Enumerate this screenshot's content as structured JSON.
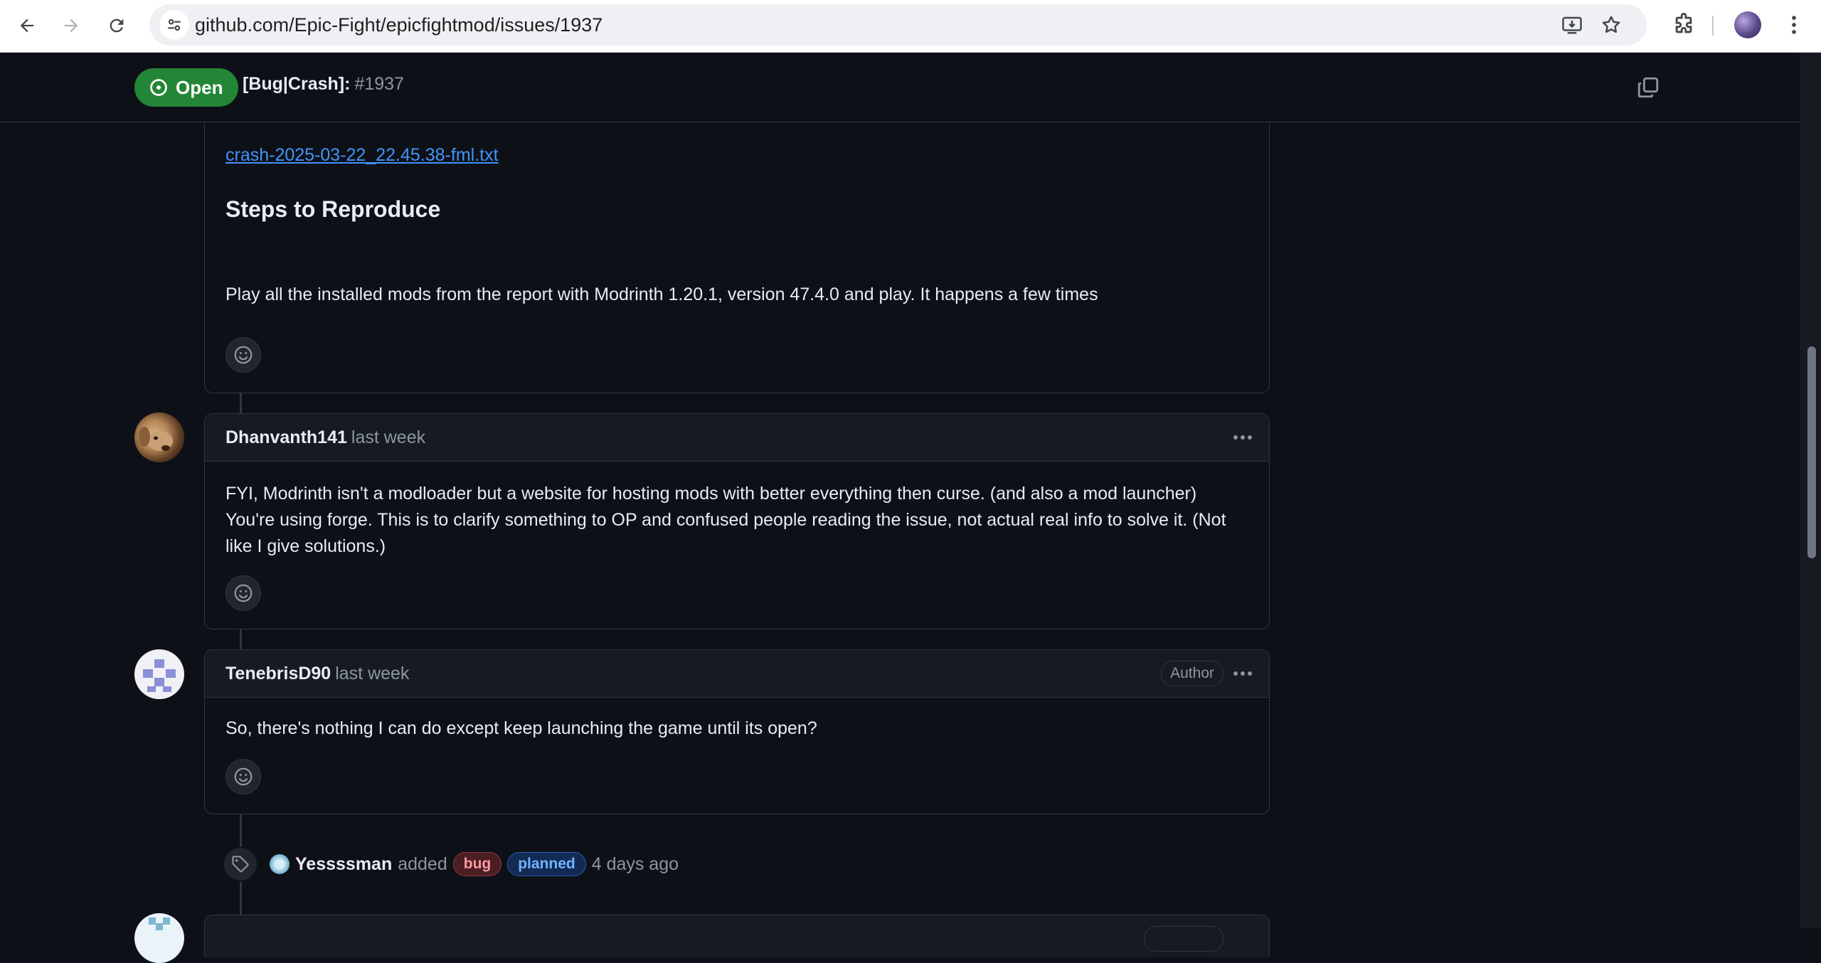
{
  "browser": {
    "url": "github.com/Epic-Fight/epicfightmod/issues/1937"
  },
  "issue": {
    "state": "Open",
    "title": "[Bug|Crash]:",
    "number": "#1937"
  },
  "body_comment": {
    "attachment": "crash-2025-03-22_22.45.38-fml.txt",
    "heading": "Steps to Reproduce",
    "text": "Play all the installed mods from the report with Modrinth 1.20.1, version 47.4.0 and play. It happens a few times"
  },
  "comments": [
    {
      "author": "Dhanvanth141",
      "time": "last week",
      "lines": [
        "FYI, Modrinth isn't a modloader but a website for hosting mods with better everything then curse. (and also a mod launcher)",
        "You're using forge. This is to clarify something to OP and confused people reading the issue, not actual real info to solve it. (Not like I give solutions.)"
      ]
    },
    {
      "author": "TenebrisD90",
      "time": "last week",
      "badge": "Author",
      "lines": [
        "So, there's nothing I can do except keep launching the game until its open?"
      ]
    }
  ],
  "label_event": {
    "actor": "Yessssman",
    "action": "added",
    "labels": [
      "bug",
      "planned"
    ],
    "time": "4 days ago"
  },
  "colors": {
    "open_green": "#238636",
    "link_blue": "#4493f8",
    "label_bug": "#ff9aa2",
    "label_planned": "#74b3ff"
  },
  "icons": {
    "back": "arrow-left-icon",
    "forward": "arrow-right-icon",
    "reload": "reload-icon",
    "site_info": "tune-icon",
    "install": "install-app-icon",
    "bookmark": "star-icon",
    "extensions": "puzzle-icon",
    "menu": "vertical-dots-icon",
    "copy": "copy-icon",
    "reaction": "smiley-icon",
    "label_event": "tag-icon"
  }
}
